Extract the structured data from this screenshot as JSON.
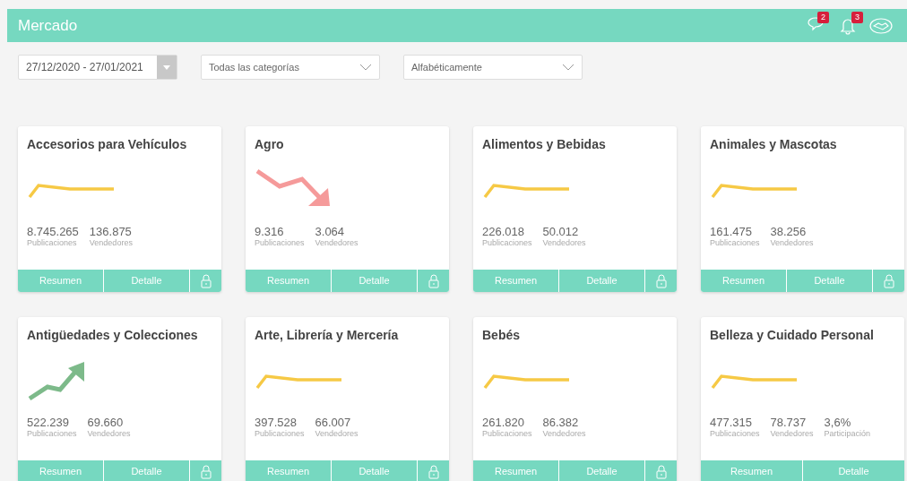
{
  "header": {
    "title": "Mercado",
    "badges": [
      {
        "kind": "chat",
        "count": "2"
      },
      {
        "kind": "bell",
        "count": "3"
      }
    ]
  },
  "filters": {
    "date_range": "27/12/2020 - 27/01/2021",
    "category": "Todas las categorías",
    "order": "Alfabéticamente"
  },
  "cards": [
    {
      "title": "Accesorios para Vehículos",
      "kind": "flat",
      "stats": [
        {
          "value": "8.745.265",
          "label": "Publicaciones"
        },
        {
          "value": "136.875",
          "label": "Vendedores"
        }
      ],
      "buttons": [
        "Resumen",
        "Detalle"
      ],
      "lock_button": true
    },
    {
      "title": "Agro",
      "kind": "down",
      "stats": [
        {
          "value": "9.316",
          "label": "Publicaciones"
        },
        {
          "value": "3.064",
          "label": "Vendedores"
        }
      ],
      "buttons": [
        "Resumen",
        "Detalle"
      ],
      "lock_button": true
    },
    {
      "title": "Alimentos y Bebidas",
      "kind": "flat",
      "stats": [
        {
          "value": "226.018",
          "label": "Publicaciones"
        },
        {
          "value": "50.012",
          "label": "Vendedores"
        }
      ],
      "buttons": [
        "Resumen",
        "Detalle"
      ],
      "lock_button": true
    },
    {
      "title": "Animales y Mascotas",
      "kind": "flat",
      "stats": [
        {
          "value": "161.475",
          "label": "Publicaciones"
        },
        {
          "value": "38.256",
          "label": "Vendedores"
        }
      ],
      "buttons": [
        "Resumen",
        "Detalle"
      ],
      "lock_button": true
    },
    {
      "title": "Antigüedades y Colecciones",
      "kind": "up",
      "stats": [
        {
          "value": "522.239",
          "label": "Publicaciones"
        },
        {
          "value": "69.660",
          "label": "Vendedores"
        }
      ],
      "buttons": [
        "Resumen",
        "Detalle"
      ],
      "lock_button": true
    },
    {
      "title": "Arte, Librería y Mercería",
      "kind": "flat",
      "stats": [
        {
          "value": "397.528",
          "label": "Publicaciones"
        },
        {
          "value": "66.007",
          "label": "Vendedores"
        }
      ],
      "buttons": [
        "Resumen",
        "Detalle"
      ],
      "lock_button": true
    },
    {
      "title": "Bebés",
      "kind": "flat",
      "stats": [
        {
          "value": "261.820",
          "label": "Publicaciones"
        },
        {
          "value": "86.382",
          "label": "Vendedores"
        }
      ],
      "buttons": [
        "Resumen",
        "Detalle"
      ],
      "lock_button": true
    },
    {
      "title": "Belleza y Cuidado Personal",
      "kind": "flat",
      "stats": [
        {
          "value": "477.315",
          "label": "Publicaciones"
        },
        {
          "value": "78.737",
          "label": "Vendedores"
        },
        {
          "value": "3,6%",
          "label": "Participación"
        }
      ],
      "buttons": [
        "Resumen",
        "Detalle"
      ],
      "lock_button": false
    }
  ]
}
